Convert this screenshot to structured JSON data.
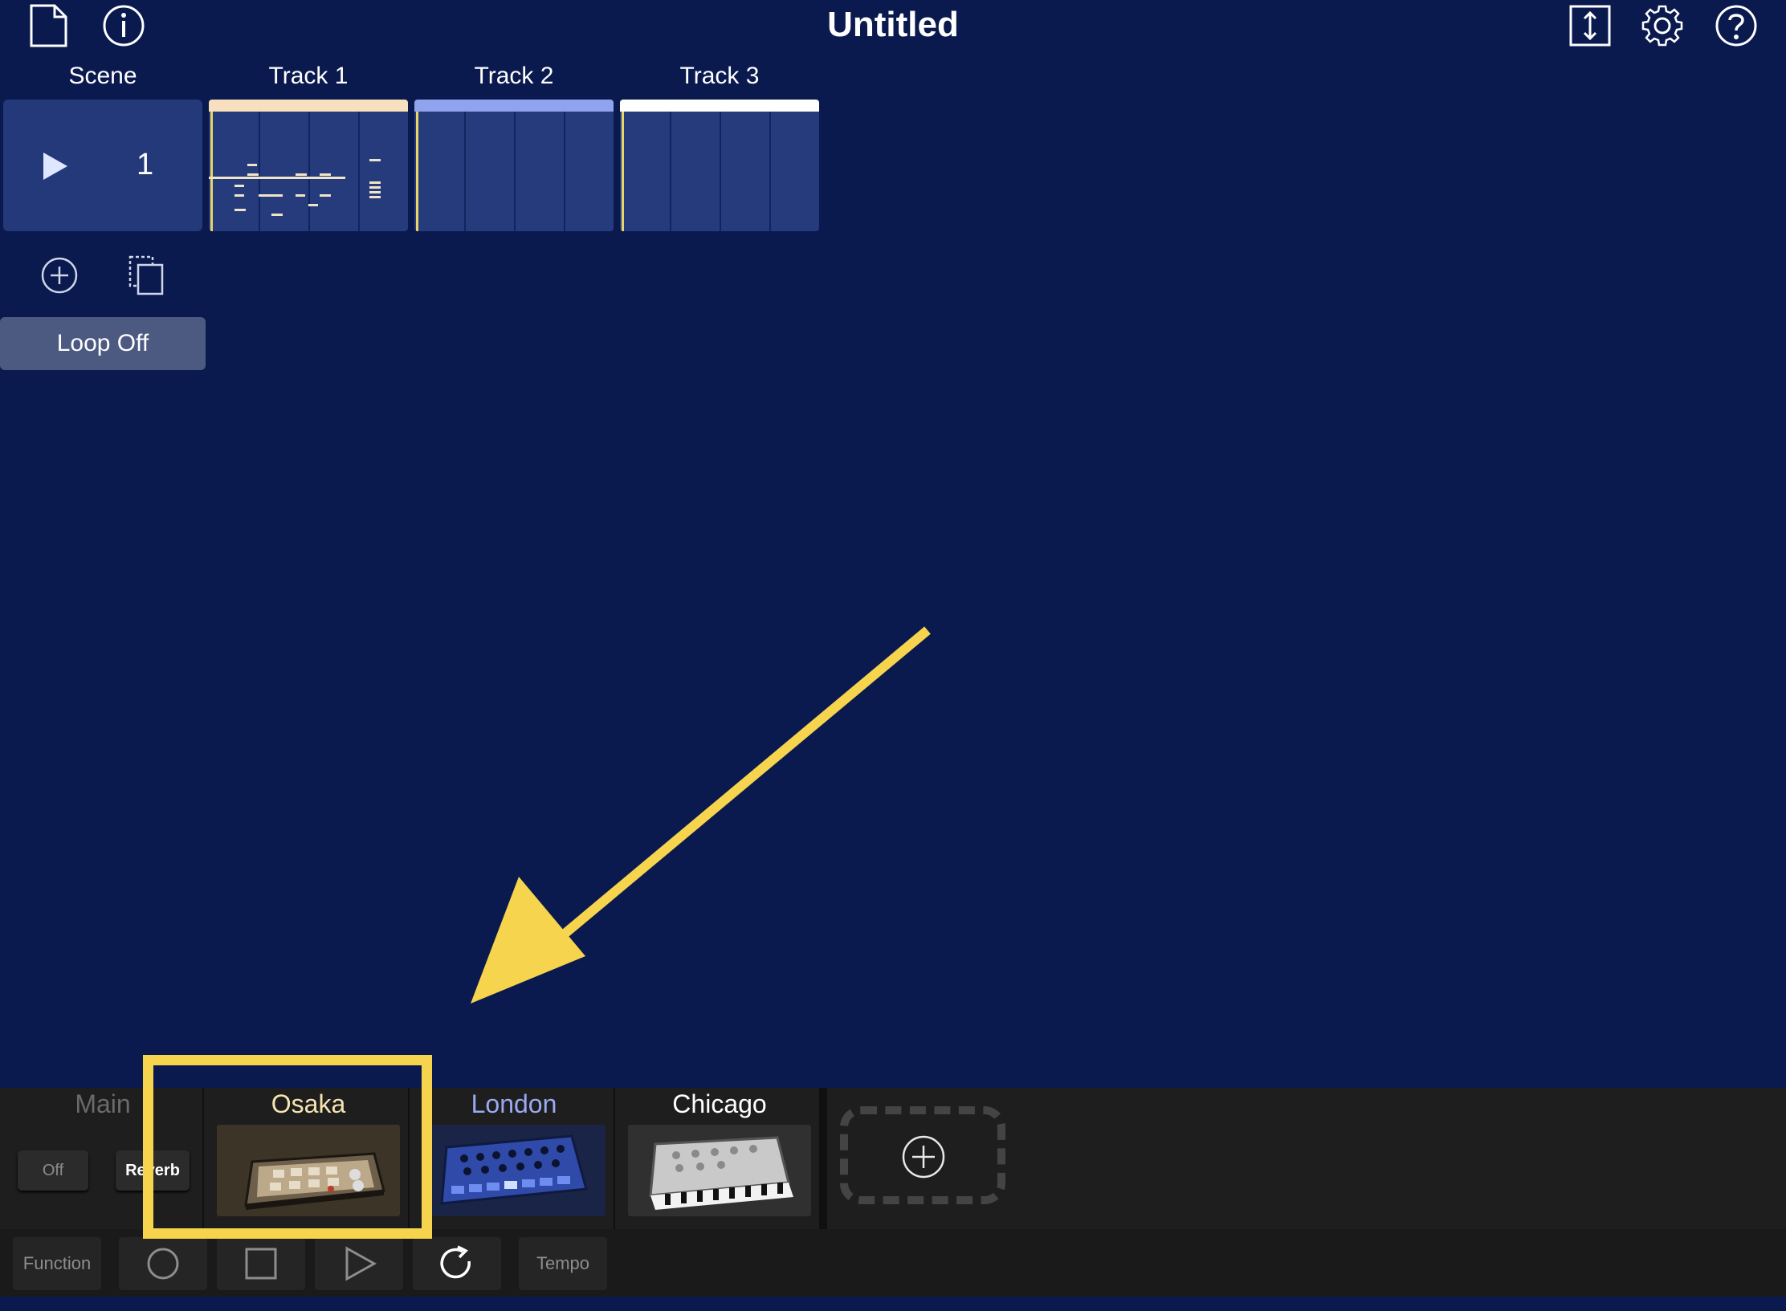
{
  "header": {
    "title": "Untitled"
  },
  "grid": {
    "scene_label": "Scene",
    "scene_number": "1",
    "tracks": [
      {
        "label": "Track 1",
        "color": "#f8dfbe"
      },
      {
        "label": "Track 2",
        "color": "#8fa3ee"
      },
      {
        "label": "Track 3",
        "color": "#ffffff"
      }
    ],
    "loop_label": "Loop Off"
  },
  "mixer": {
    "main": {
      "label": "Main",
      "off_label": "Off",
      "reverb_label": "Reverb"
    },
    "strips": [
      {
        "label": "Osaka",
        "color": "#f6e4b0"
      },
      {
        "label": "London",
        "color": "#9aa9f2"
      },
      {
        "label": "Chicago",
        "color": "#ffffff"
      }
    ]
  },
  "transport": {
    "function_label": "Function",
    "tempo_label": "Tempo"
  },
  "annotation": {
    "highlight_color": "#f6d44e"
  }
}
